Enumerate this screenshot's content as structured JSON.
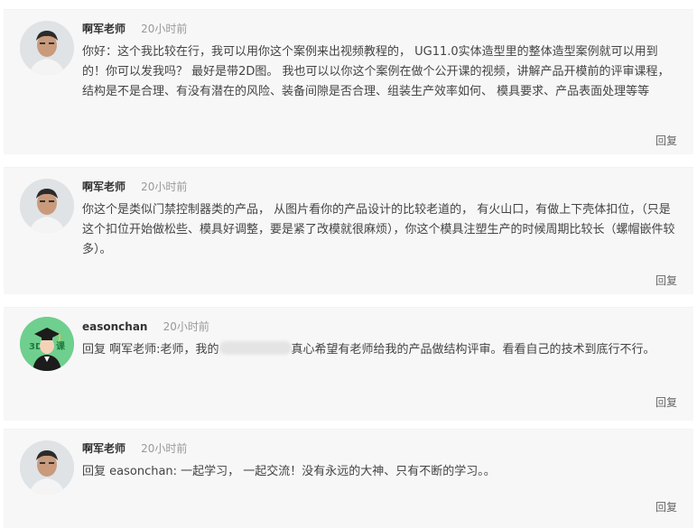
{
  "comments": [
    {
      "author": "啊军老师",
      "time": "20小时前",
      "avatar_icon": "teacher-avatar",
      "content": "你好：这个我比较在行，我可以用你这个案例来出视频教程的， UG11.0实体造型里的整体造型案例就可以用到的！你可以发我吗？ 最好是带2D图。 我也可以以你这个案例在做个公开课的视频，讲解产品开模前的评审课程，结构是不是合理、有没有潜在的风险、装备间隙是否合理、组装生产效率如何、 模具要求、产品表面处理等等",
      "reply_label": "回复"
    },
    {
      "author": "啊军老师",
      "time": "20小时前",
      "avatar_icon": "teacher-avatar",
      "content": "你这个是类似门禁控制器类的产品， 从图片看你的产品设计的比较老道的， 有火山口，有做上下壳体扣位，（只是这个扣位开始做松些、模具好调整，要是紧了改模就很麻烦），你这个模具注塑生产的时候周期比较长（螺帽嵌件较多）。",
      "reply_label": "回复"
    },
    {
      "author": "easonchan",
      "time": "20小时前",
      "avatar_icon": "graduate-avatar",
      "avatar_text": "3D",
      "content_before": "回复 啊军老师:老师，我的",
      "content_after": "真心希望有老师给我的产品做结构评审。看看自己的技术到底行不行。",
      "reply_label": "回复"
    },
    {
      "author": "啊军老师",
      "time": "20小时前",
      "avatar_icon": "teacher-avatar",
      "content": "回复 easonchan: 一起学习， 一起交流！没有永远的大神、只有不断的学习。。",
      "reply_label": "回复"
    }
  ],
  "colors": {
    "author": "#333333",
    "time": "#999999",
    "content": "#444444",
    "background": "#f7f7f7",
    "graduate_avatar_bg": "#6fcf8e"
  }
}
